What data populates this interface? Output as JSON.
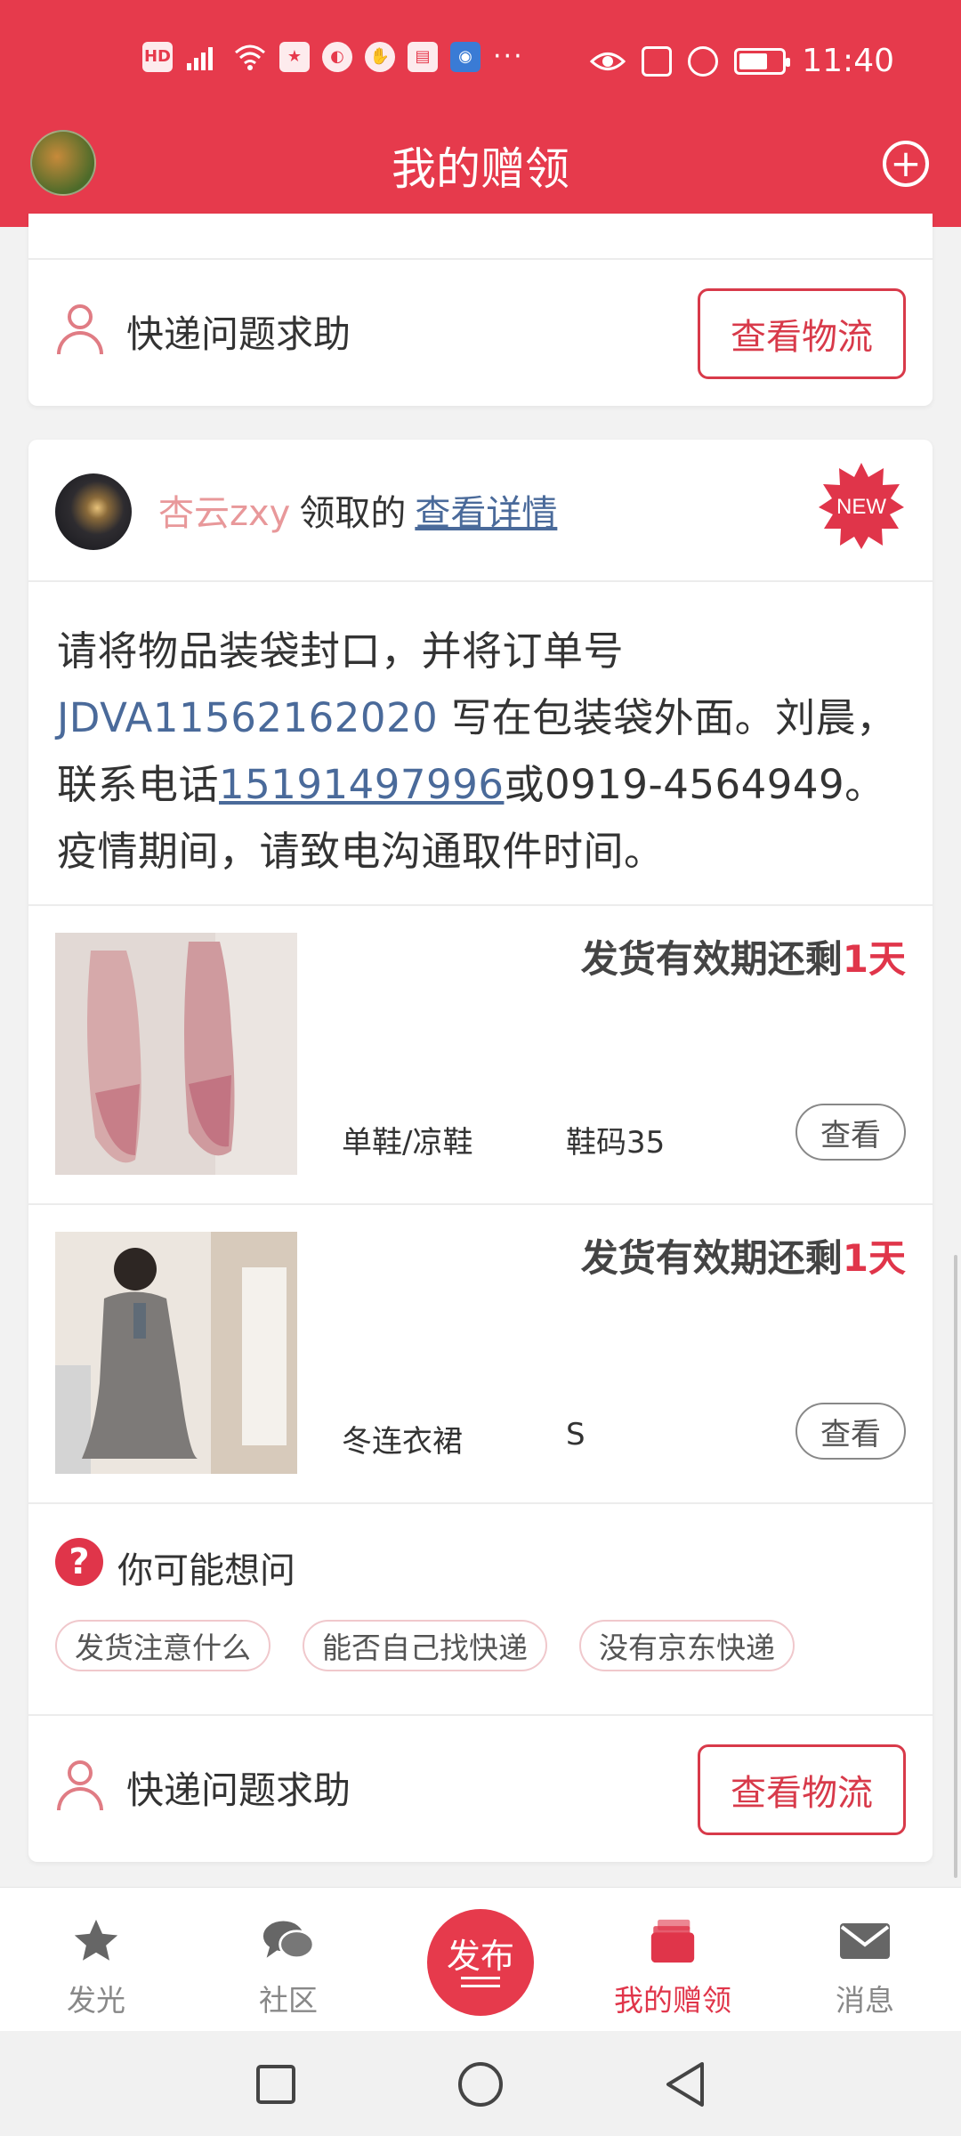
{
  "status_bar": {
    "left_icons": [
      "hd-icon",
      "signal-4g-icon",
      "wifi-icon",
      "star-app-icon",
      "ball-app-icon",
      "shield-app-icon",
      "book-app-icon",
      "bulb-app-icon"
    ],
    "hd_label": "HD",
    "overflow": "···",
    "time": "11:40"
  },
  "header": {
    "title": "我的赠领",
    "add_symbol": "+"
  },
  "card_top": {
    "help_label": "快递问题求助",
    "logistics_label": "查看物流"
  },
  "card_main": {
    "receiver_name": "杏云zxy",
    "receiver_mid": "领取的",
    "detail_link": "查看详情",
    "badge": "NEW",
    "note": {
      "p1": "请将物品装袋封口，并将订单号 ",
      "order_no": "JDVA11562162020",
      "p2": " 写在包装袋外面。刘晨，联系电话",
      "phone": "15191497996",
      "p3": "或0919-4564949。疫情期间，请致电沟通取件时间。"
    },
    "items": [
      {
        "deadline_prefix": "发货有效期还剩",
        "days": "1天",
        "category": "单鞋/凉鞋",
        "size": "鞋码35",
        "view": "查看"
      },
      {
        "deadline_prefix": "发货有效期还剩",
        "days": "1天",
        "category": "冬连衣裙",
        "size": "S",
        "view": "查看"
      }
    ],
    "ask": {
      "icon": "?",
      "title": "你可能想问",
      "chips": [
        "发货注意什么",
        "能否自己找快递",
        "没有京东快递"
      ]
    },
    "help_label": "快递问题求助",
    "logistics_label": "查看物流"
  },
  "bottom_nav": {
    "items": [
      {
        "label": "发光",
        "icon": "star-icon"
      },
      {
        "label": "社区",
        "icon": "chat-icon"
      },
      {
        "label": "发布",
        "icon": "publish-icon"
      },
      {
        "label": "我的赠领",
        "icon": "gift-cards-icon"
      },
      {
        "label": "消息",
        "icon": "mail-icon"
      }
    ],
    "active_color": "#e0354a"
  },
  "theme": {
    "brand": "#e63a4c",
    "link": "#4a6a9a",
    "name_pink": "#e8989a"
  }
}
